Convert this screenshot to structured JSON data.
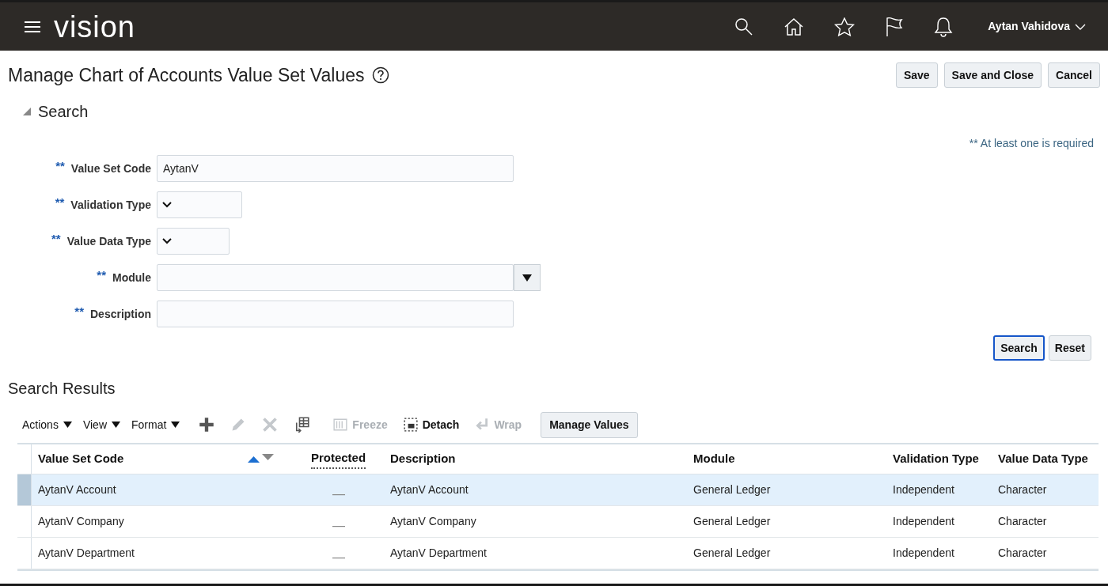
{
  "header": {
    "logo": "vision",
    "user": "Aytan Vahidova"
  },
  "page": {
    "title": "Manage Chart of Accounts Value Set Values",
    "buttons": [
      "Save",
      "Save and Close",
      "Cancel"
    ]
  },
  "search": {
    "heading": "Search",
    "expanded": true,
    "required_note": "** At least one is required",
    "fields": [
      {
        "marker": "**",
        "label": "Value Set Code",
        "kind": "text",
        "value": "AytanV"
      },
      {
        "marker": "**",
        "label": "Validation Type",
        "kind": "select"
      },
      {
        "marker": "**",
        "label": "Value Data Type",
        "kind": "select"
      },
      {
        "marker": "**",
        "label": "Module",
        "kind": "combo"
      },
      {
        "marker": "**",
        "label": "Description",
        "kind": "text"
      }
    ],
    "buttons": [
      {
        "label": "Search",
        "selected": true
      },
      {
        "label": "Reset",
        "selected": false
      }
    ]
  },
  "results": {
    "heading": "Search Results",
    "toolbar": [
      {
        "kind": "menu",
        "label": "Actions",
        "disabled": false
      },
      {
        "kind": "menu",
        "label": "View",
        "disabled": false
      },
      {
        "kind": "menu",
        "label": "Format",
        "disabled": false
      },
      {
        "kind": "icon",
        "disabled": false
      },
      {
        "kind": "icon",
        "disabled": true
      },
      {
        "kind": "icon",
        "disabled": true
      },
      {
        "kind": "icon",
        "disabled": false
      },
      {
        "kind": "action",
        "label": "Freeze",
        "disabled": true
      },
      {
        "kind": "action",
        "label": "Detach",
        "disabled": false
      },
      {
        "kind": "action",
        "label": "Wrap",
        "disabled": true
      },
      {
        "kind": "button",
        "label": "Manage Values",
        "disabled": false
      }
    ],
    "columns": [
      "Value Set Code",
      "Protected",
      "Description",
      "Module",
      "Validation Type",
      "Value Data Type"
    ],
    "rows": [
      {
        "selected": true,
        "value_set_code": "AytanV Account",
        "protected": false,
        "description": "AytanV Account",
        "module": "General Ledger",
        "validation_type": "Independent",
        "value_data_type": "Character"
      },
      {
        "selected": false,
        "value_set_code": "AytanV Company",
        "protected": false,
        "description": "AytanV Company",
        "module": "General Ledger",
        "validation_type": "Independent",
        "value_data_type": "Character"
      },
      {
        "selected": false,
        "value_set_code": "AytanV Department",
        "protected": false,
        "description": "AytanV Department",
        "module": "General Ledger",
        "validation_type": "Independent",
        "value_data_type": "Character"
      }
    ]
  }
}
